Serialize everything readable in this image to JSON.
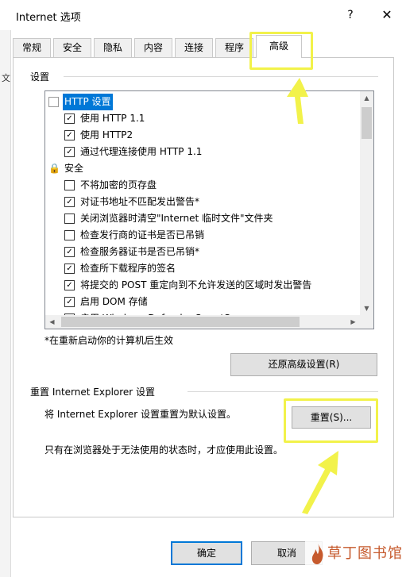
{
  "window": {
    "title": "Internet 选项",
    "help": "?",
    "close": "✕"
  },
  "left_fragment": "文",
  "tabs": [
    {
      "label": "常规",
      "active": false
    },
    {
      "label": "安全",
      "active": false
    },
    {
      "label": "隐私",
      "active": false
    },
    {
      "label": "内容",
      "active": false
    },
    {
      "label": "连接",
      "active": false
    },
    {
      "label": "程序",
      "active": false
    },
    {
      "label": "高级",
      "active": true
    }
  ],
  "settings": {
    "group_label": "设置",
    "rows": [
      {
        "label": "HTTP 设置",
        "kind": "category",
        "icon": "document-icon",
        "selected": true
      },
      {
        "label": "使用 HTTP 1.1",
        "kind": "checkbox",
        "checked": true
      },
      {
        "label": "使用 HTTP2",
        "kind": "checkbox",
        "checked": true
      },
      {
        "label": "通过代理连接使用 HTTP 1.1",
        "kind": "checkbox",
        "checked": true
      },
      {
        "label": "安全",
        "kind": "category",
        "icon": "lock-icon",
        "selected": false
      },
      {
        "label": "不将加密的页存盘",
        "kind": "checkbox",
        "checked": false
      },
      {
        "label": "对证书地址不匹配发出警告*",
        "kind": "checkbox",
        "checked": true
      },
      {
        "label": "关闭浏览器时清空\"Internet 临时文件\"文件夹",
        "kind": "checkbox",
        "checked": false
      },
      {
        "label": "检查发行商的证书是否已吊销",
        "kind": "checkbox",
        "checked": false
      },
      {
        "label": "检查服务器证书是否已吊销*",
        "kind": "checkbox",
        "checked": true
      },
      {
        "label": "检查所下载程序的签名",
        "kind": "checkbox",
        "checked": true
      },
      {
        "label": "将提交的 POST 重定向到不允许发送的区域时发出警告",
        "kind": "checkbox",
        "checked": true
      },
      {
        "label": "启用 DOM 存储",
        "kind": "checkbox",
        "checked": true
      },
      {
        "label": "启用 Windows Defender SmartScreen",
        "kind": "checkbox",
        "checked": true
      }
    ],
    "restart_note": "*在重新启动你的计算机后生效",
    "restore_button": "还原高级设置(R)"
  },
  "reset_section": {
    "group_label": "重置 Internet Explorer 设置",
    "description": "将 Internet Explorer 设置重置为默认设置。",
    "reset_button": "重置(S)...",
    "note": "只有在浏览器处于无法使用的状态时，才应使用此设置。"
  },
  "footer": {
    "ok_button": "确定",
    "cancel_button": "取消"
  },
  "watermark": {
    "text": "草丁图书馆"
  },
  "colors": {
    "highlight": "#f2f24a",
    "selection": "#0078d7",
    "watermark": "#c65a2d"
  }
}
